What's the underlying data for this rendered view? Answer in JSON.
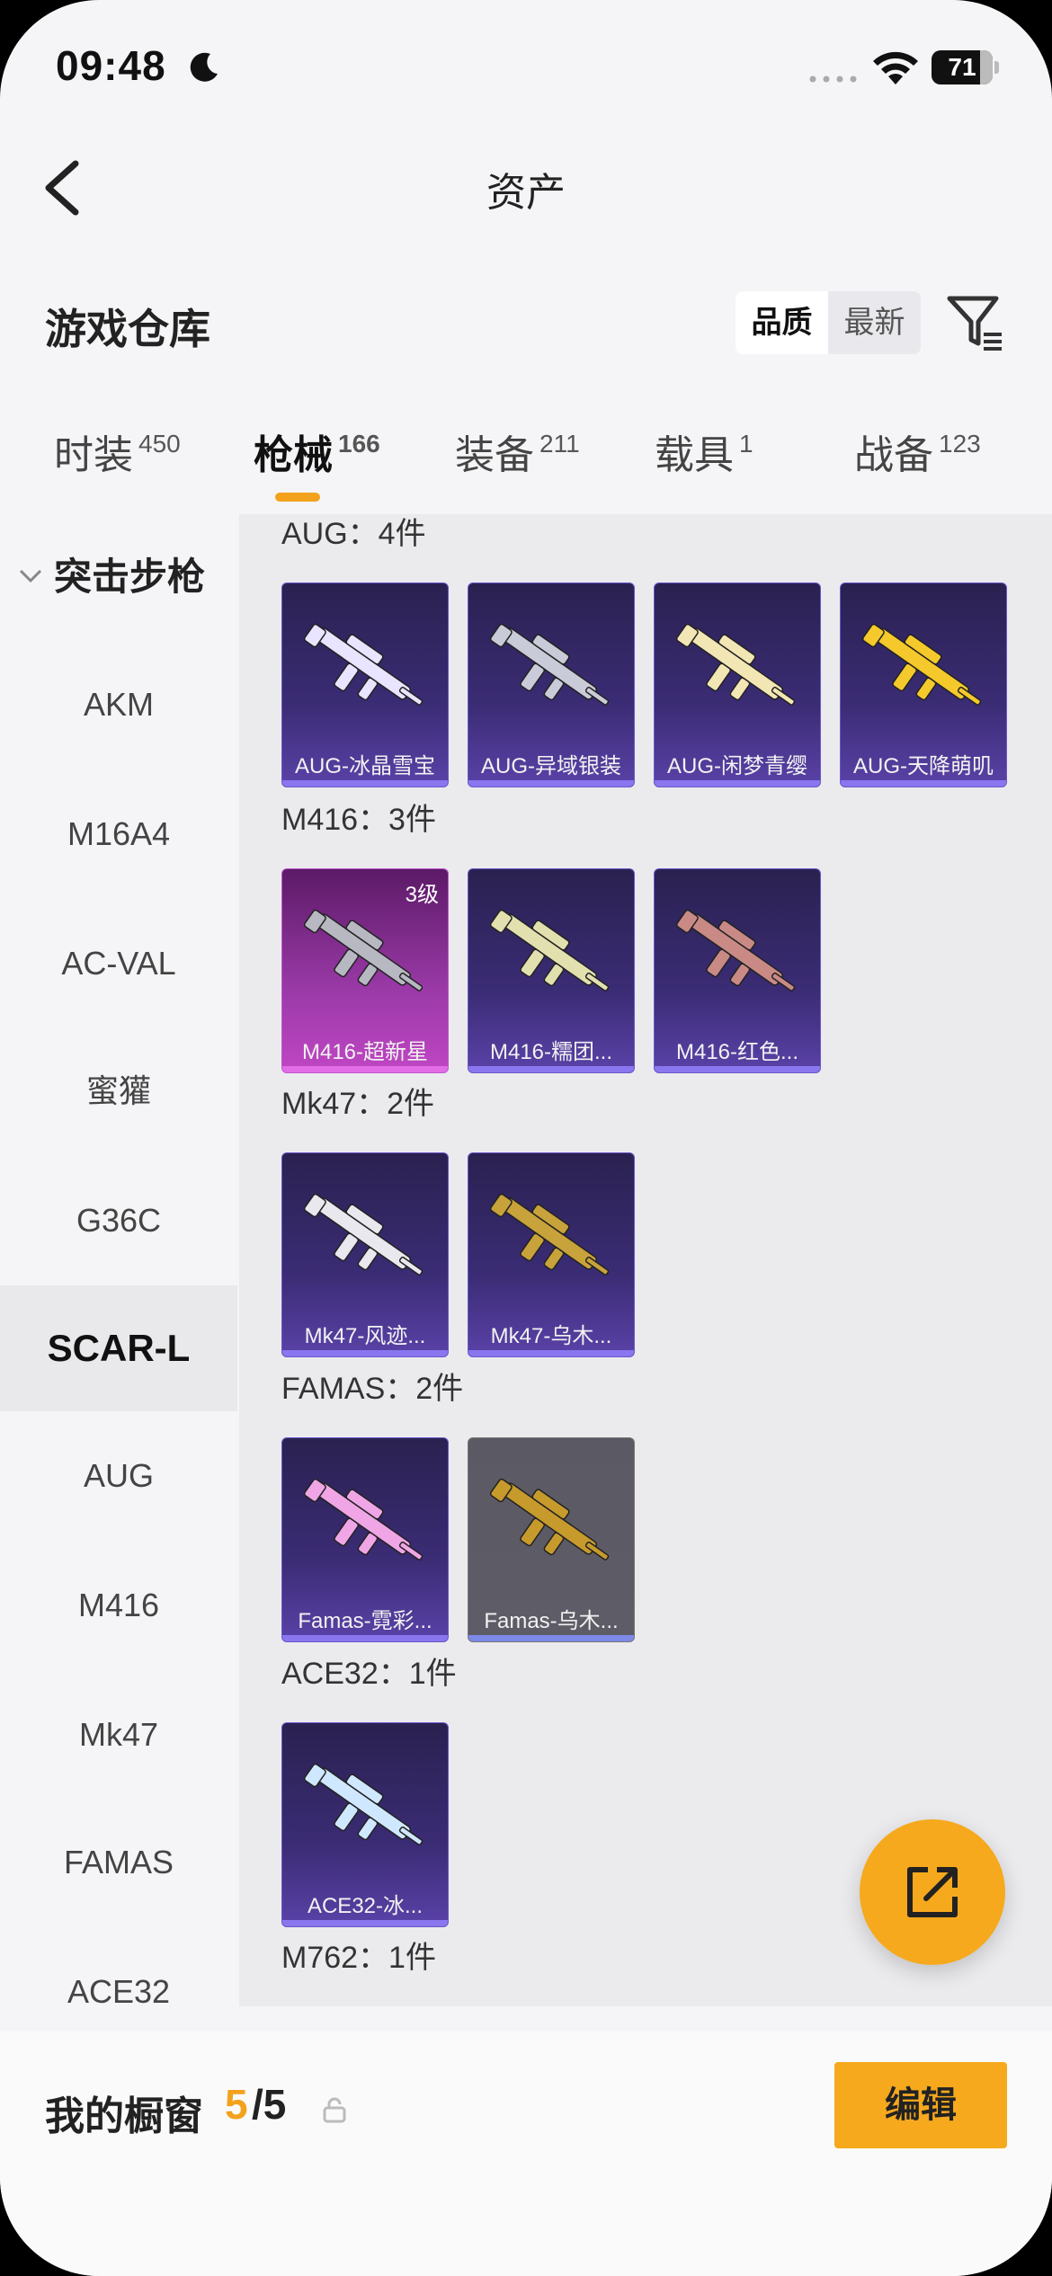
{
  "status": {
    "time": "09:48",
    "battery": "71"
  },
  "nav": {
    "title": "资产"
  },
  "header": {
    "title": "游戏仓库",
    "sort": [
      "品质",
      "最新"
    ]
  },
  "tabs": [
    {
      "label": "时装",
      "count": "450"
    },
    {
      "label": "枪械",
      "count": "166"
    },
    {
      "label": "装备",
      "count": "211"
    },
    {
      "label": "载具",
      "count": "1"
    },
    {
      "label": "战备",
      "count": "123"
    }
  ],
  "sidebar": {
    "category": "突击步枪",
    "items": [
      "AKM",
      "M16A4",
      "AC-VAL",
      "蜜獾",
      "G36C",
      "SCAR-L",
      "AUG",
      "M416",
      "Mk47",
      "FAMAS",
      "ACE32"
    ],
    "selected": "SCAR-L"
  },
  "groups": [
    {
      "title": "AUG：4件",
      "items": [
        {
          "label": "AUG-冰晶雪宝",
          "style": "purple",
          "color": "#e9e4ff"
        },
        {
          "label": "AUG-异域银装",
          "style": "purple",
          "color": "#c9ccd8"
        },
        {
          "label": "AUG-闲梦青缨",
          "style": "purple",
          "color": "#f3e6b5"
        },
        {
          "label": "AUG-天降萌叽",
          "style": "purple",
          "color": "#f5c92c"
        }
      ]
    },
    {
      "title": "M416：3件",
      "items": [
        {
          "label": "M416-超新星",
          "style": "pink",
          "level": "3级",
          "color": "#b8b8c2"
        },
        {
          "label": "M416-糯团...",
          "style": "purple",
          "color": "#e3e0b0"
        },
        {
          "label": "M416-红色...",
          "style": "purple",
          "color": "#c98a86"
        }
      ]
    },
    {
      "title": "Mk47：2件",
      "items": [
        {
          "label": "Mk47-风迹...",
          "style": "purple",
          "color": "#e8e8ee"
        },
        {
          "label": "Mk47-乌木...",
          "style": "purple",
          "color": "#c8a23a"
        }
      ]
    },
    {
      "title": "FAMAS：2件",
      "items": [
        {
          "label": "Famas-霓彩...",
          "style": "purple",
          "color": "#f0a6e6"
        },
        {
          "label": "Famas-乌木...",
          "style": "gray",
          "color": "#c79a2c"
        }
      ]
    },
    {
      "title": "ACE32：1件",
      "items": [
        {
          "label": "ACE32-冰...",
          "style": "purple",
          "color": "#cfe8ff"
        }
      ]
    },
    {
      "title": "M762：1件",
      "items": []
    }
  ],
  "bottom": {
    "label": "我的橱窗",
    "current": "5",
    "total": "/5",
    "edit": "编辑"
  }
}
